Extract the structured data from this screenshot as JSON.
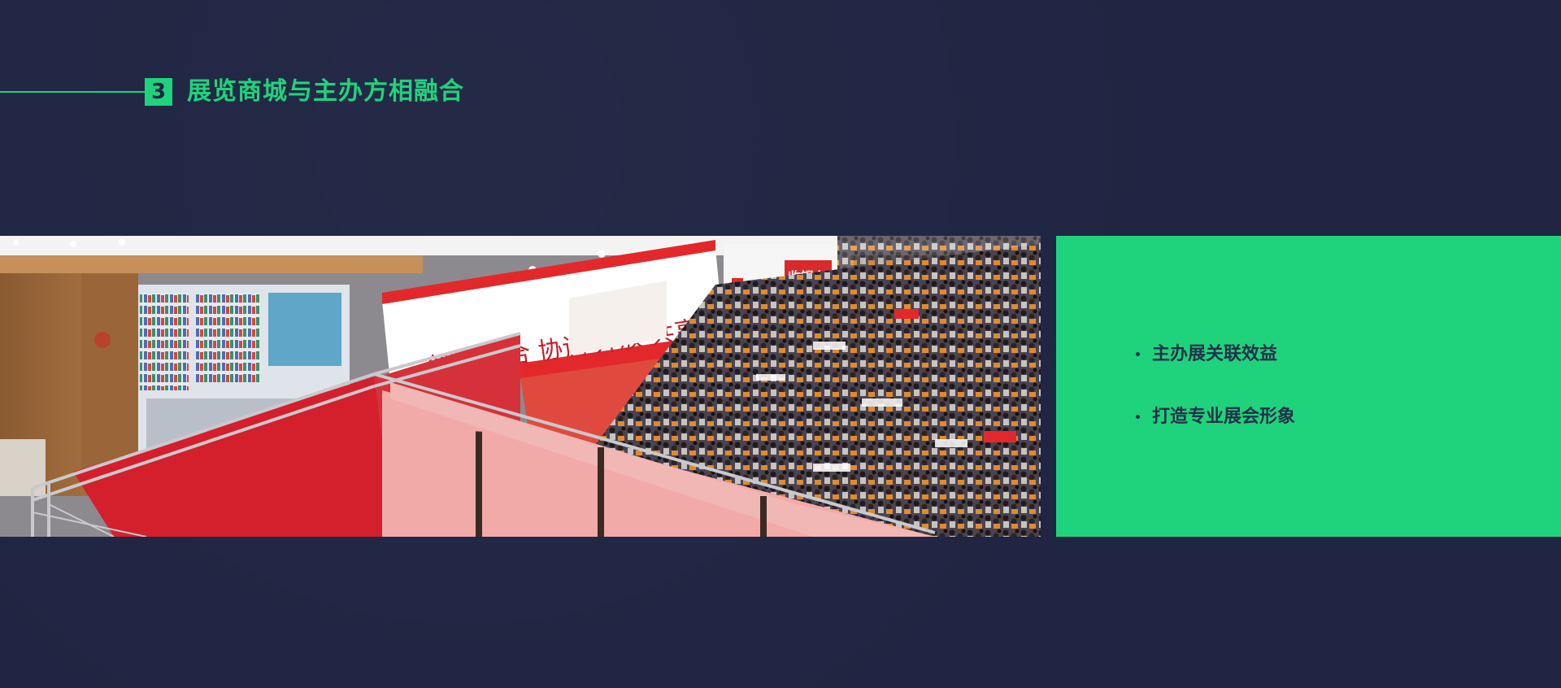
{
  "header": {
    "section_number": "3",
    "title": "展览商城与主办方相融合"
  },
  "photo": {
    "banner_text": "创新  融合  协调  开放  共享",
    "cashier_sign": "收银台"
  },
  "panel": {
    "bullets": [
      {
        "label": "主办展关联效益"
      },
      {
        "label": "打造专业展会形象"
      }
    ]
  },
  "colors": {
    "background": "#1f2542",
    "accent": "#1fd37c",
    "panel_text": "#23304a"
  }
}
